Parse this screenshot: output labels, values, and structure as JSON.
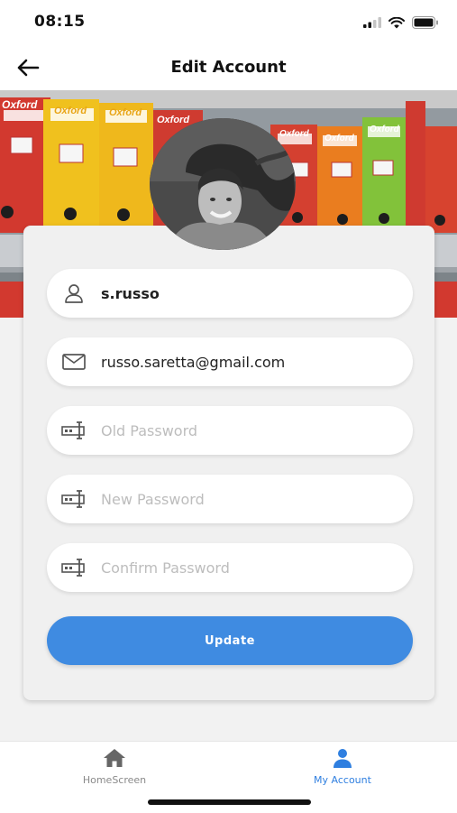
{
  "status": {
    "time": "08:15"
  },
  "header": {
    "title": "Edit Account"
  },
  "banner": {
    "brand_text": "Oxford"
  },
  "form": {
    "username": {
      "value": "s.russo"
    },
    "email": {
      "value": "russo.saretta@gmail.com"
    },
    "old_password": {
      "placeholder": "Old Password"
    },
    "new_password": {
      "placeholder": "New Password"
    },
    "confirm_password": {
      "placeholder": "Confirm Password"
    },
    "update_label": "Update"
  },
  "tabbar": {
    "items": [
      {
        "label": "HomeScreen",
        "icon": "home-icon"
      },
      {
        "label": "My Account",
        "icon": "person-icon",
        "active": true
      }
    ]
  },
  "colors": {
    "accent": "#3f8be1",
    "active_tab": "#2f7fe0",
    "background": "#f2f2f2"
  }
}
